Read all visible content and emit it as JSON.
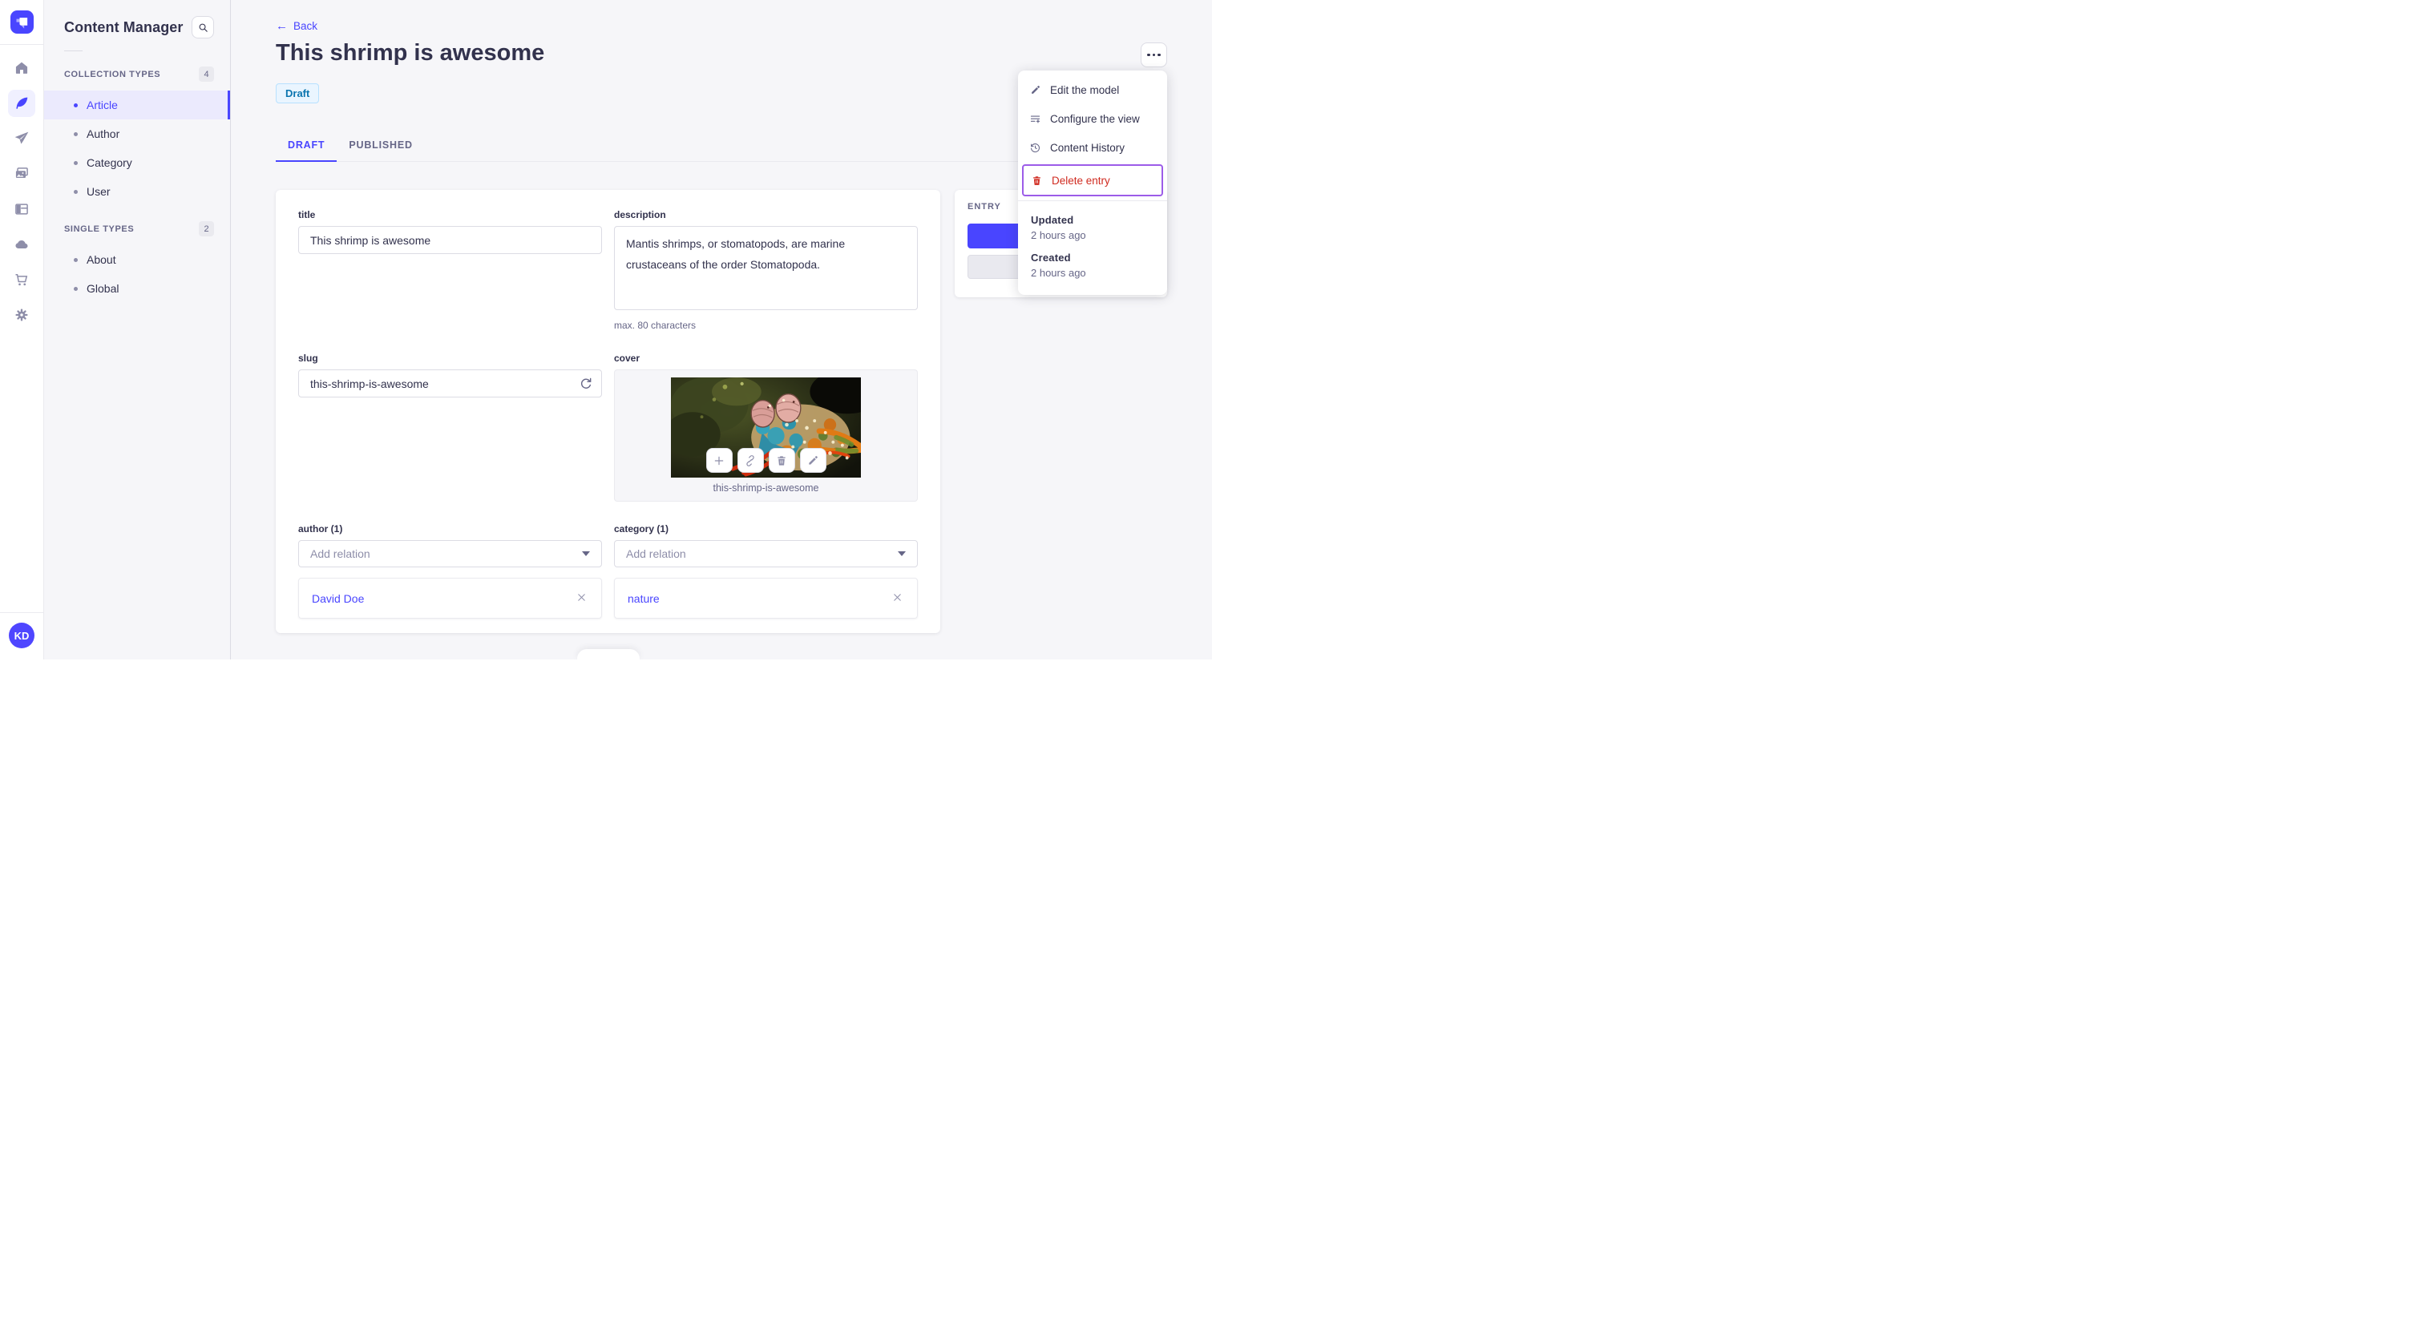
{
  "app": {
    "avatar_initials": "KD",
    "nav_icons": [
      "strapi-logo",
      "home",
      "content-manager",
      "releases",
      "media-library",
      "content-type-builder",
      "deploy",
      "marketplace",
      "settings"
    ]
  },
  "sidebar": {
    "title": "Content Manager",
    "sections": [
      {
        "label": "COLLECTION TYPES",
        "count": "4",
        "items": [
          {
            "label": "Article"
          },
          {
            "label": "Author"
          },
          {
            "label": "Category"
          },
          {
            "label": "User"
          }
        ]
      },
      {
        "label": "SINGLE TYPES",
        "count": "2",
        "items": [
          {
            "label": "About"
          },
          {
            "label": "Global"
          }
        ]
      }
    ]
  },
  "header": {
    "back_arrow": "←",
    "back_label": "Back",
    "title": "This shrimp is awesome",
    "status_badge": "Draft"
  },
  "tabs": [
    {
      "label": "DRAFT"
    },
    {
      "label": "PUBLISHED"
    }
  ],
  "form": {
    "title": {
      "label": "title",
      "value": "This shrimp is awesome"
    },
    "description": {
      "label": "description",
      "value": "Mantis shrimps, or stomatopods, are marine crustaceans of the order Stomatopoda.",
      "hint": "max. 80 characters"
    },
    "slug": {
      "label": "slug",
      "value": "this-shrimp-is-awesome"
    },
    "cover": {
      "label": "cover",
      "caption": "this-shrimp-is-awesome",
      "action_icons": [
        "plus-icon",
        "link-icon",
        "trash-icon",
        "pencil-icon"
      ]
    },
    "author": {
      "label": "author (1)",
      "placeholder": "Add relation",
      "relation": "David Doe"
    },
    "category": {
      "label": "category (1)",
      "placeholder": "Add relation",
      "relation": "nature"
    }
  },
  "entry_panel": {
    "title": "ENTRY"
  },
  "context_menu": {
    "items": [
      {
        "label": "Edit the model",
        "icon": "pencil-icon"
      },
      {
        "label": "Configure the view",
        "icon": "configure-list-icon"
      },
      {
        "label": "Content History",
        "icon": "history-icon"
      },
      {
        "label": "Delete entry",
        "icon": "trash-icon"
      }
    ],
    "meta": [
      {
        "label": "Updated",
        "value": "2 hours ago"
      },
      {
        "label": "Created",
        "value": "2 hours ago"
      }
    ]
  },
  "colors": {
    "primary": "#4945ff",
    "danger": "#d02b20",
    "focus_outline": "#9c5ce8",
    "draft_badge_bg": "#eaf5ff",
    "draft_badge_border": "#b8e1ff",
    "draft_badge_text": "#0c75af",
    "main_background": "#f6f6f9"
  }
}
